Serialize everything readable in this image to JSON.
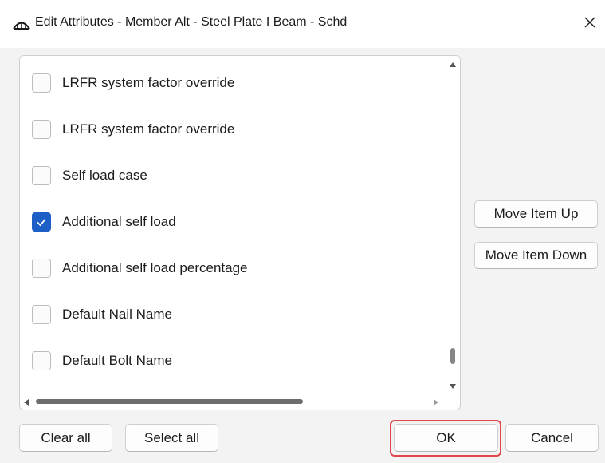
{
  "window": {
    "title": "Edit Attributes - Member Alt - Steel Plate I Beam - Schd",
    "app_icon": "bridge-icon",
    "close_icon": "close-icon"
  },
  "attribute_list": {
    "items": [
      {
        "label": "LRFR system factor override",
        "checked": false
      },
      {
        "label": "LRFR system factor override",
        "checked": false
      },
      {
        "label": "Self load case",
        "checked": false
      },
      {
        "label": "Additional self load",
        "checked": true
      },
      {
        "label": "Additional self load percentage",
        "checked": false
      },
      {
        "label": "Default Nail Name",
        "checked": false
      },
      {
        "label": "Default Bolt Name",
        "checked": false
      }
    ]
  },
  "side_buttons": {
    "move_up": "Move Item Up",
    "move_down": "Move Item Down"
  },
  "footer": {
    "clear_all": "Clear all",
    "select_all": "Select all",
    "ok": "OK",
    "cancel": "Cancel"
  },
  "colors": {
    "accent": "#1d5ec7",
    "ok_highlight": "#e0474c"
  }
}
